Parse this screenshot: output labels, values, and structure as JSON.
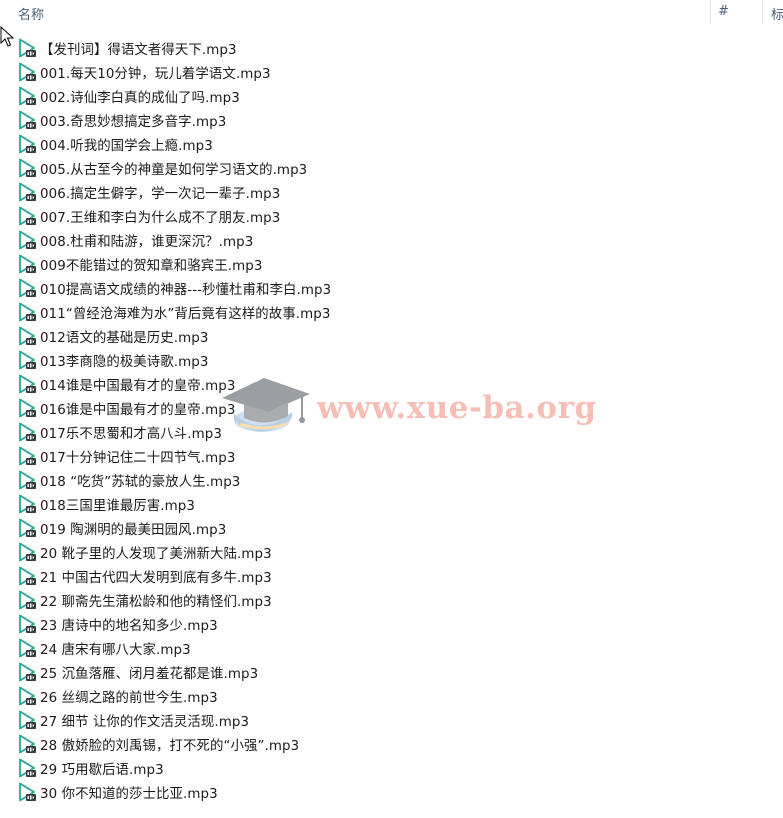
{
  "header": {
    "name_label": "名称",
    "number_label": "#",
    "title_label": "标"
  },
  "watermark": {
    "text": "www.xue-ba.org"
  },
  "icons": {
    "file_icon": "audio-file-icon",
    "cursor_icon": "mouse-pointer-icon"
  },
  "colors": {
    "play_triangle": "#2aa39a",
    "watermark": "#f08a7a"
  },
  "files": [
    "【发刊词】得语文者得天下.mp3",
    "001.每天10分钟，玩儿着学语文.mp3",
    "002.诗仙李白真的成仙了吗.mp3",
    "003.奇思妙想搞定多音字.mp3",
    "004.听我的国学会上瘾.mp3",
    "005.从古至今的神童是如何学习语文的.mp3",
    "006.搞定生僻字，学一次记一辈子.mp3",
    "007.王维和李白为什么成不了朋友.mp3",
    "008.杜甫和陆游，谁更深沉？.mp3",
    "009不能错过的贺知章和骆宾王.mp3",
    "010提高语文成绩的神器---秒懂杜甫和李白.mp3",
    "011“曾经沧海难为水”背后竟有这样的故事.mp3",
    "012语文的基础是历史.mp3",
    "013李商隐的极美诗歌.mp3",
    "014谁是中国最有才的皇帝.mp3",
    "016谁是中国最有才的皇帝.mp3",
    "017乐不思蜀和才高八斗.mp3",
    "017十分钟记住二十四节气.mp3",
    "018 “吃货”苏轼的豪放人生.mp3",
    "018三国里谁最厉害.mp3",
    "019 陶渊明的最美田园风.mp3",
    "20 靴子里的人发现了美洲新大陆.mp3",
    "21 中国古代四大发明到底有多牛.mp3",
    "22 聊斋先生蒲松龄和他的精怪们.mp3",
    "23 唐诗中的地名知多少.mp3",
    "24 唐宋有哪八大家.mp3",
    "25 沉鱼落雁、闭月羞花都是谁.mp3",
    "26 丝绸之路的前世今生.mp3",
    "27 细节 让你的作文活灵活现.mp3",
    "28 傲娇脸的刘禹锡，打不死的“小强”.mp3",
    "29 巧用歇后语.mp3",
    "30 你不知道的莎士比亚.mp3"
  ]
}
